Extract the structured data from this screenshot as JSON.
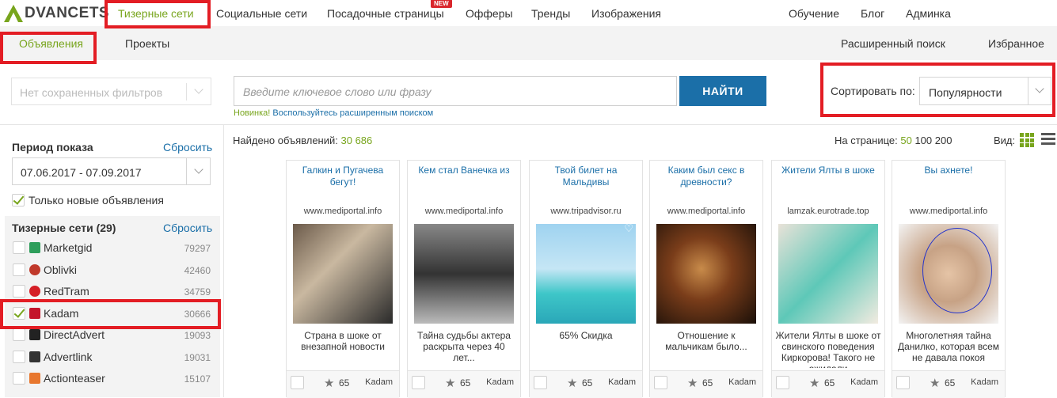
{
  "logo": {
    "text": "DVANCETS"
  },
  "topnav": {
    "items": [
      "Тизерные сети",
      "Социальные сети",
      "Посадочные страницы",
      "Офферы",
      "Тренды",
      "Изображения"
    ],
    "right_items": [
      "Обучение",
      "Блог",
      "Админка"
    ],
    "new_badge": "NEW"
  },
  "subnav": {
    "items": [
      "Объявления",
      "Проекты"
    ],
    "right_items": [
      "Расширенный поиск",
      "Избранное"
    ]
  },
  "filters": {
    "saved_placeholder": "Нет сохраненных фильтров",
    "search_placeholder": "Введите ключевое слово или фразу",
    "search_button": "НАЙТИ",
    "hint_new": "Новинка!",
    "hint_text": "Воспользуйтесь расширенным поиском",
    "sort_label": "Сортировать по:",
    "sort_value": "Популярности"
  },
  "sidebar": {
    "period_title": "Период показа",
    "reset": "Сбросить",
    "date_range": "07.06.2017 - 07.09.2017",
    "only_new": "Только новые объявления",
    "networks_title": "Тизерные сети (29)",
    "networks": [
      {
        "name": "Marketgid",
        "count": "79297",
        "checked": false,
        "icon": "marketgid-icon",
        "color": "#2e9e5b"
      },
      {
        "name": "Oblivki",
        "count": "42460",
        "checked": false,
        "icon": "oblivki-icon",
        "color": "#c0392b"
      },
      {
        "name": "RedTram",
        "count": "34759",
        "checked": false,
        "icon": "redtram-icon",
        "color": "#d51f26"
      },
      {
        "name": "Kadam",
        "count": "30666",
        "checked": true,
        "icon": "kadam-icon",
        "color": "#c4142b"
      },
      {
        "name": "DirectAdvert",
        "count": "19093",
        "checked": false,
        "icon": "directadvert-icon",
        "color": "#222222"
      },
      {
        "name": "Advertlink",
        "count": "19031",
        "checked": false,
        "icon": "advertlink-icon",
        "color": "#333333"
      },
      {
        "name": "Actionteaser",
        "count": "15107",
        "checked": false,
        "icon": "actionteaser-icon",
        "color": "#e8772e"
      }
    ]
  },
  "results": {
    "found_label": "Найдено объявлений:",
    "found_count": "30 686",
    "per_page_label": "На странице:",
    "per_page_options": [
      "50",
      "100",
      "200"
    ],
    "view_label": "Вид:"
  },
  "cards": [
    {
      "title": "Галкин и Пугачева бегут!",
      "domain": "www.mediportal.info",
      "desc": "Страна в шоке от внезапной новости",
      "rating": "65",
      "network": "Kadam"
    },
    {
      "title": "Кем стал Ванечка из",
      "domain": "www.mediportal.info",
      "desc": "Тайна судьбы актера раскрыта через 40 лет...",
      "rating": "65",
      "network": "Kadam"
    },
    {
      "title": "Твой билет на Мальдивы",
      "domain": "www.tripadvisor.ru",
      "desc": "65% Скидка",
      "rating": "65",
      "network": "Kadam"
    },
    {
      "title": "Каким был секс в древности?",
      "domain": "www.mediportal.info",
      "desc": "Отношение к мальчикам было...",
      "rating": "65",
      "network": "Kadam"
    },
    {
      "title": "Жители Ялты в шоке",
      "domain": "lamzak.eurotrade.top",
      "desc": "Жители Ялты в шоке от свинского поведения Киркорова! Такого не ожидали",
      "rating": "65",
      "network": "Kadam"
    },
    {
      "title": "Вы ахнете!",
      "domain": "www.mediportal.info",
      "desc": "Многолетняя тайна Данилко, которая всем не давала покоя",
      "rating": "65",
      "network": "Kadam"
    }
  ]
}
